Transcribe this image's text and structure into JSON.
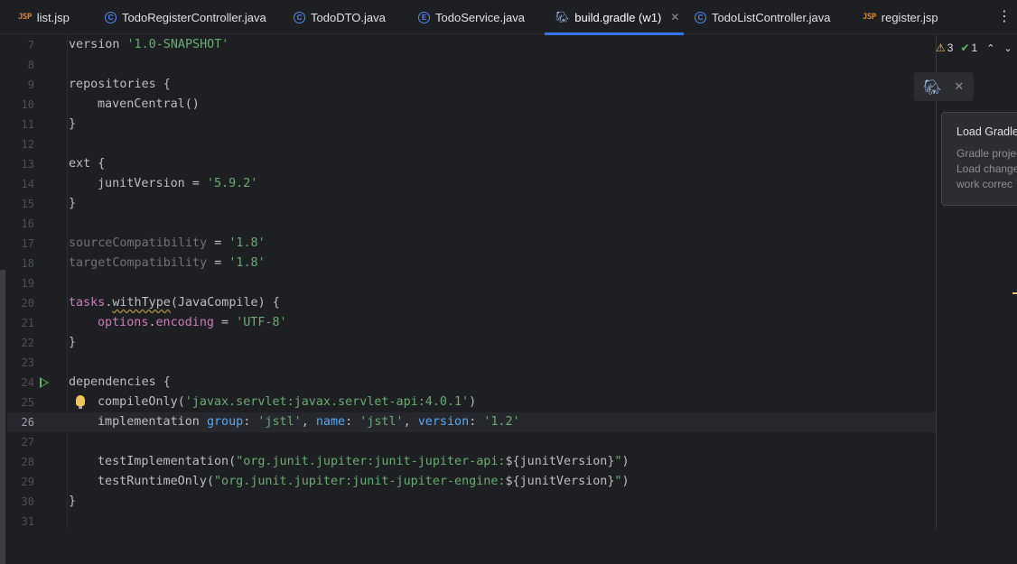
{
  "tabs": [
    {
      "label": "list.jsp",
      "icon": "jsp-file-icon",
      "icon_text": "JSP"
    },
    {
      "label": "TodoRegisterController.java",
      "icon": "class-icon",
      "icon_text": "C"
    },
    {
      "label": "TodoDTO.java",
      "icon": "class-icon",
      "icon_text": "C"
    },
    {
      "label": "TodoService.java",
      "icon": "enum-icon",
      "icon_text": "E"
    },
    {
      "label": "build.gradle (w1)",
      "icon": "gradle-icon",
      "active": true
    },
    {
      "label": "TodoListController.java",
      "icon": "class-icon",
      "icon_text": "C"
    },
    {
      "label": "register.jsp",
      "icon": "jsp-file-icon",
      "icon_text": "JSP"
    }
  ],
  "inspections": {
    "warnings": "3",
    "weak_warnings": "1"
  },
  "gradle_tooltip": {
    "title": "Load Gradle",
    "line1": "Gradle projec",
    "line2": "Load change",
    "line3": "work correc"
  },
  "editor": {
    "current_line": 26,
    "lines": [
      {
        "n": "7",
        "t": [
          "version",
          " ",
          "'1.0-SNAPSHOT'"
        ]
      },
      {
        "n": "8"
      },
      {
        "n": "9",
        "t": [
          "repositories {"
        ]
      },
      {
        "n": "10",
        "t": [
          "mavenCentral()"
        ]
      },
      {
        "n": "11",
        "t": [
          "}"
        ]
      },
      {
        "n": "12"
      },
      {
        "n": "13",
        "t": [
          "ext {"
        ]
      },
      {
        "n": "14",
        "t": [
          "junitVersion = ",
          "'5.9.2'"
        ]
      },
      {
        "n": "15",
        "t": [
          "}"
        ]
      },
      {
        "n": "16"
      },
      {
        "n": "17",
        "t": [
          "sourceCompatibility",
          " = ",
          "'1.8'"
        ]
      },
      {
        "n": "18",
        "t": [
          "targetCompatibility",
          " = ",
          "'1.8'"
        ]
      },
      {
        "n": "19"
      },
      {
        "n": "20",
        "t": [
          "tasks",
          ".",
          "withType",
          "(JavaCompile) {"
        ]
      },
      {
        "n": "21",
        "t": [
          "options",
          ".",
          "encoding",
          " = ",
          "'UTF-8'"
        ]
      },
      {
        "n": "22",
        "t": [
          "}"
        ]
      },
      {
        "n": "23"
      },
      {
        "n": "24",
        "t": [
          "dependencies {"
        ]
      },
      {
        "n": "25",
        "t": [
          "compileOnly",
          "(",
          "'javax.servlet:javax.servlet-api:4.0.1'",
          ")"
        ]
      },
      {
        "n": "26",
        "t": [
          "implementation ",
          "group",
          ": ",
          "'jstl'",
          ", ",
          "name",
          ": ",
          "'jstl'",
          ", ",
          "version",
          ": ",
          "'1.2'"
        ]
      },
      {
        "n": "27"
      },
      {
        "n": "28",
        "t": [
          "testImplementation",
          "(",
          "\"org.junit.jupiter:junit-jupiter-api:",
          "${junitVersion}",
          "\"",
          ")"
        ]
      },
      {
        "n": "29",
        "t": [
          "testRuntimeOnly",
          "(",
          "\"org.junit.jupiter:junit-jupiter-engine:",
          "${junitVersion}",
          "\"",
          ")"
        ]
      },
      {
        "n": "30",
        "t": [
          "}"
        ]
      },
      {
        "n": "31"
      }
    ]
  }
}
